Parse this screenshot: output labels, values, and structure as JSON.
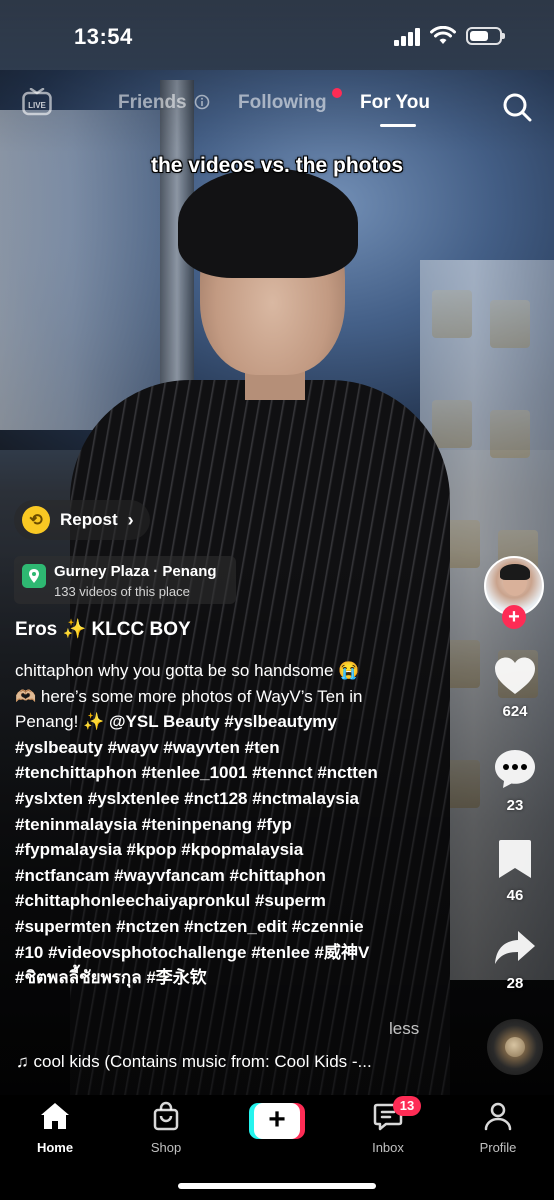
{
  "status_bar": {
    "time": "13:54"
  },
  "top_nav": {
    "live_label": "LIVE",
    "tabs": [
      {
        "label": "Friends"
      },
      {
        "label": "Following"
      },
      {
        "label": "For You"
      }
    ],
    "active_tab": "For You"
  },
  "video": {
    "caption_overlay": "the videos vs. the photos"
  },
  "repost": {
    "label": "Repost"
  },
  "location": {
    "name": "Gurney Plaza · Penang",
    "subtitle": "133 videos of this place"
  },
  "post": {
    "username": "Eros ✨ KLCC BOY",
    "line1": "chittaphon why you gotta be so handsome 😭",
    "line2": "🫶🏼 here’s some more photos of WayV’s Ten in",
    "line3_plain": "Penang! ✨ ",
    "line3_tags": "@YSL Beauty #yslbeautymy",
    "hashtag_lines": [
      "#yslbeauty #wayv #wayvten #ten",
      "#tenchittaphon #tenlee_1001 #tennct #nctten",
      "#yslxten #yslxtenlee #nct128 #nctmalaysia",
      "#teninmalaysia #teninpenang #fyp",
      "#fypmalaysia #kpop #kpopmalaysia",
      "#nctfancam #wayvfancam #chittaphon",
      "#chittaphonleechaiyapronkul #superm",
      "#supermten #nctzen #nctzen_edit #czennie",
      "#10 #videovsphotochallenge #tenlee #威神V",
      "#ชิตพลลี้ชัยพรกุล #李永钦"
    ],
    "less_label": "less",
    "music": "cool kids (Contains music from: Cool Kids -..."
  },
  "actions": {
    "likes": "624",
    "comments": "23",
    "saves": "46",
    "shares": "28",
    "follow_symbol": "+"
  },
  "tabbar": {
    "home": "Home",
    "shop": "Shop",
    "create_symbol": "+",
    "inbox": "Inbox",
    "inbox_badge": "13",
    "profile": "Profile"
  },
  "colors": {
    "accent": "#fe2c55",
    "cyan": "#25f4ee",
    "location_pin": "#2eb872",
    "repost": "#f9c823"
  }
}
